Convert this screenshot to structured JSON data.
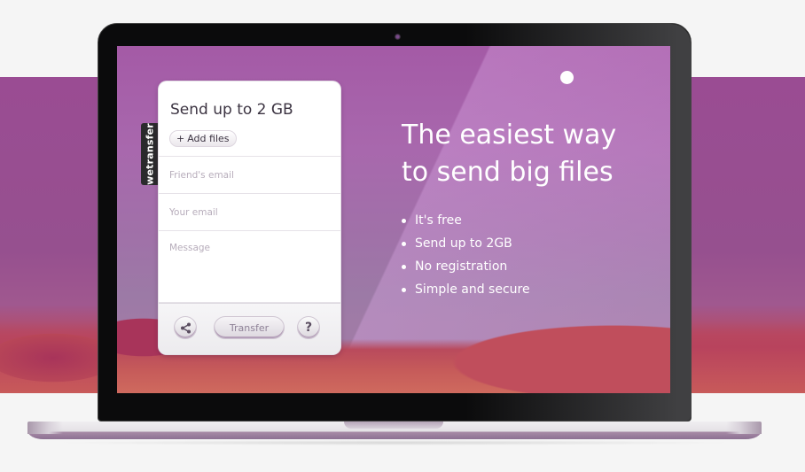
{
  "brand": {
    "name": "wetransfer"
  },
  "card": {
    "title": "Send up to 2 GB",
    "add_files_icon": "plus-icon",
    "add_files_label": "Add files",
    "friends_email_placeholder": "Friend's email",
    "friends_email_value": "",
    "your_email_placeholder": "Your email",
    "your_email_value": "",
    "message_placeholder": "Message",
    "message_value": "",
    "share_icon": "share-icon",
    "transfer_label": "Transfer",
    "help_label": "?"
  },
  "hero": {
    "headline_line1": "The easiest way",
    "headline_line2": "to send big files",
    "features": [
      "It's free",
      "Send up to 2GB",
      "No registration",
      "Simple and secure"
    ]
  },
  "colors": {
    "background": "#f5f5f5",
    "accent_purple": "#9a4c93",
    "card_text": "#3c3442",
    "placeholder": "#b7adbb"
  }
}
